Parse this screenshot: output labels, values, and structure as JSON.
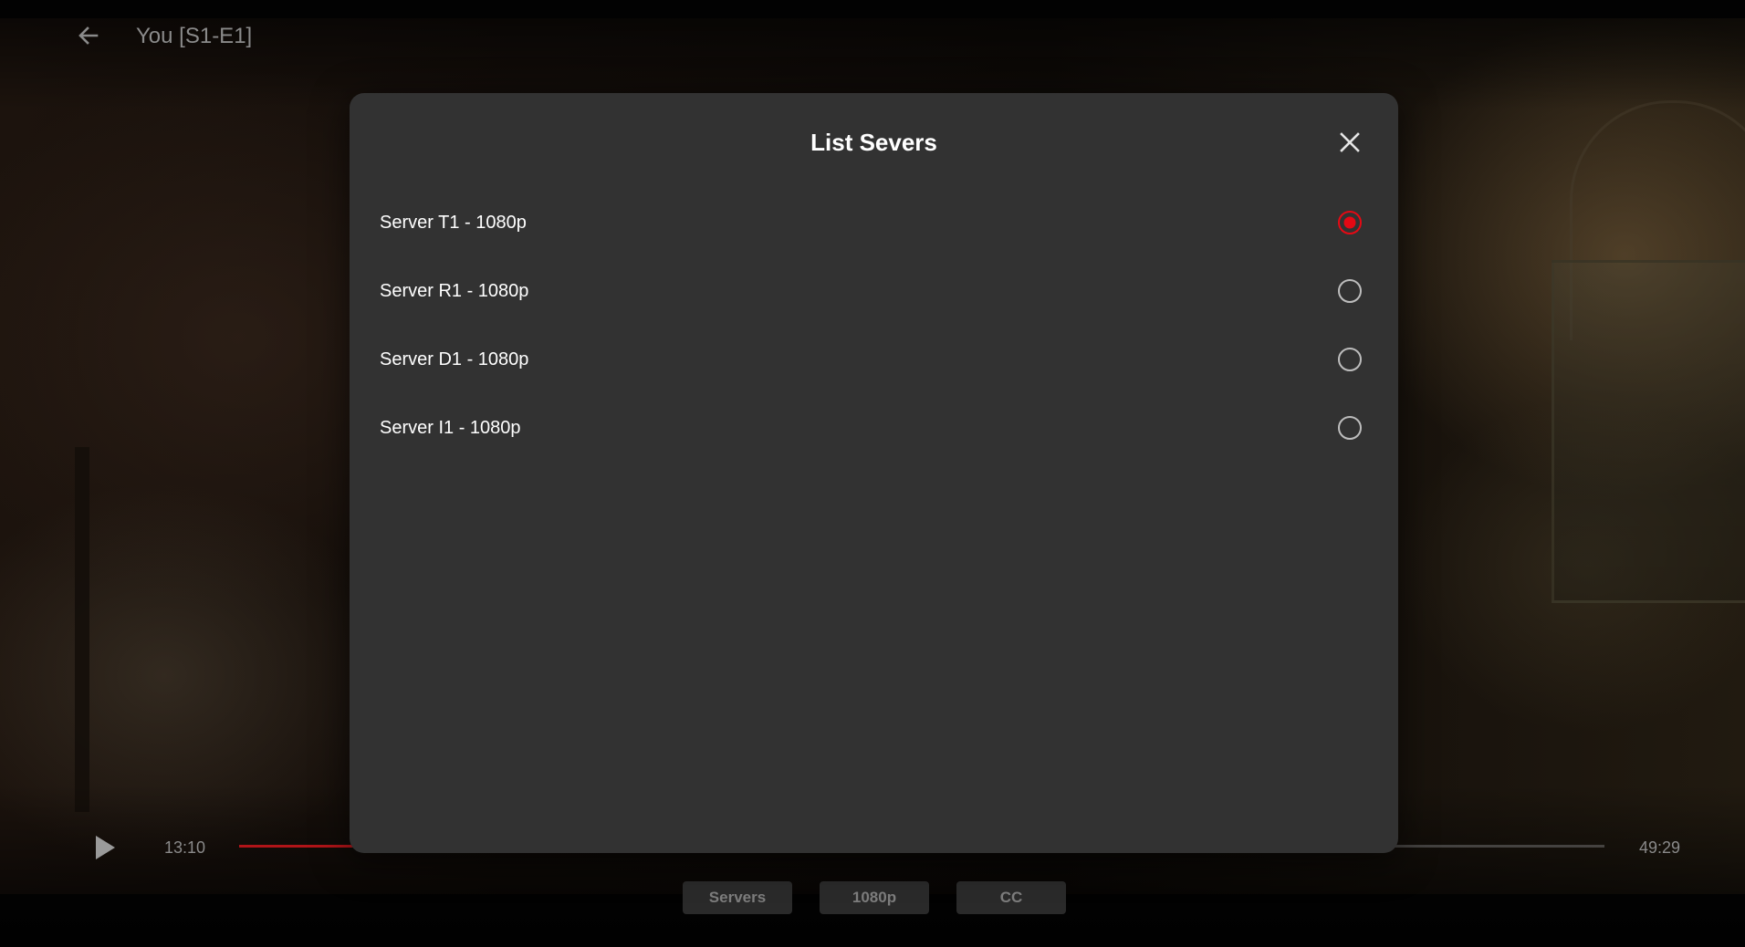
{
  "header": {
    "title": "You [S1-E1]",
    "back_icon": "arrow-left-icon"
  },
  "player": {
    "current_time": "13:10",
    "total_time": "49:29",
    "progress_fraction": 0.265,
    "play_icon": "play-icon",
    "buttons": {
      "servers": "Servers",
      "quality": "1080p",
      "cc": "CC"
    }
  },
  "dialog": {
    "title": "List Severs",
    "close_icon": "close-icon",
    "accent_color": "#e50914",
    "servers": [
      {
        "label": "Server T1 - 1080p",
        "selected": true
      },
      {
        "label": "Server R1 - 1080p",
        "selected": false
      },
      {
        "label": "Server D1 - 1080p",
        "selected": false
      },
      {
        "label": "Server I1 - 1080p",
        "selected": false
      }
    ]
  }
}
